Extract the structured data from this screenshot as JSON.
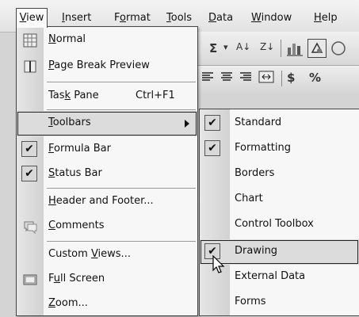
{
  "menubar": {
    "items": [
      {
        "label": "View",
        "u": "V",
        "rest": "iew"
      },
      {
        "label": "Insert",
        "u": "I",
        "rest": "nsert"
      },
      {
        "label": "Format",
        "pre": "F",
        "u": "o",
        "rest": "rmat"
      },
      {
        "label": "Tools",
        "u": "T",
        "rest": "ools"
      },
      {
        "label": "Data",
        "u": "D",
        "rest": "ata"
      },
      {
        "label": "Window",
        "u": "W",
        "rest": "indow"
      },
      {
        "label": "Help",
        "u": "H",
        "rest": "elp"
      }
    ]
  },
  "toolbar": {
    "sigma": "Σ",
    "dropdown": "▾",
    "sort_asc": "A↓",
    "sort_desc": "Z↓",
    "currency": "$",
    "percent": "%"
  },
  "view_menu": {
    "items": [
      {
        "label": "Normal",
        "u": "N",
        "rest": "ormal",
        "icon": "normal-view-icon"
      },
      {
        "label": "Page Break Preview",
        "u": "P",
        "rest": "age Break Preview",
        "icon": "page-break-icon"
      },
      {
        "label": "Task Pane",
        "pre": "Tas",
        "u": "k",
        "rest": " Pane",
        "shortcut": "Ctrl+F1"
      },
      {
        "label": "Toolbars",
        "u": "T",
        "rest": "oolbars",
        "submenu": true,
        "highlighted": true
      },
      {
        "label": "Formula Bar",
        "u": "F",
        "rest": "ormula Bar",
        "checked": true
      },
      {
        "label": "Status Bar",
        "u": "S",
        "rest": "tatus Bar",
        "checked": true
      },
      {
        "label": "Header and Footer...",
        "u": "H",
        "rest": "eader and Footer..."
      },
      {
        "label": "Comments",
        "u": "C",
        "rest": "omments",
        "icon": "comments-icon"
      },
      {
        "label": "Custom Views...",
        "pre": "Custom ",
        "u": "V",
        "rest": "iews..."
      },
      {
        "label": "Full Screen",
        "pre": "F",
        "u": "u",
        "rest": "ll Screen",
        "icon": "full-screen-icon"
      },
      {
        "label": "Zoom...",
        "u": "Z",
        "rest": "oom..."
      }
    ]
  },
  "toolbars_submenu": {
    "items": [
      {
        "label": "Standard",
        "checked": true
      },
      {
        "label": "Formatting",
        "checked": true
      },
      {
        "label": "Borders"
      },
      {
        "label": "Chart"
      },
      {
        "label": "Control Toolbox"
      },
      {
        "label": "Drawing",
        "checked": true,
        "highlighted": true
      },
      {
        "label": "External Data"
      },
      {
        "label": "Forms"
      }
    ]
  },
  "colors": {
    "menu_bg": "#f7f7f7",
    "icon_strip": "#d8d8d8",
    "highlight": "#dcdcdc",
    "border": "#444444"
  }
}
